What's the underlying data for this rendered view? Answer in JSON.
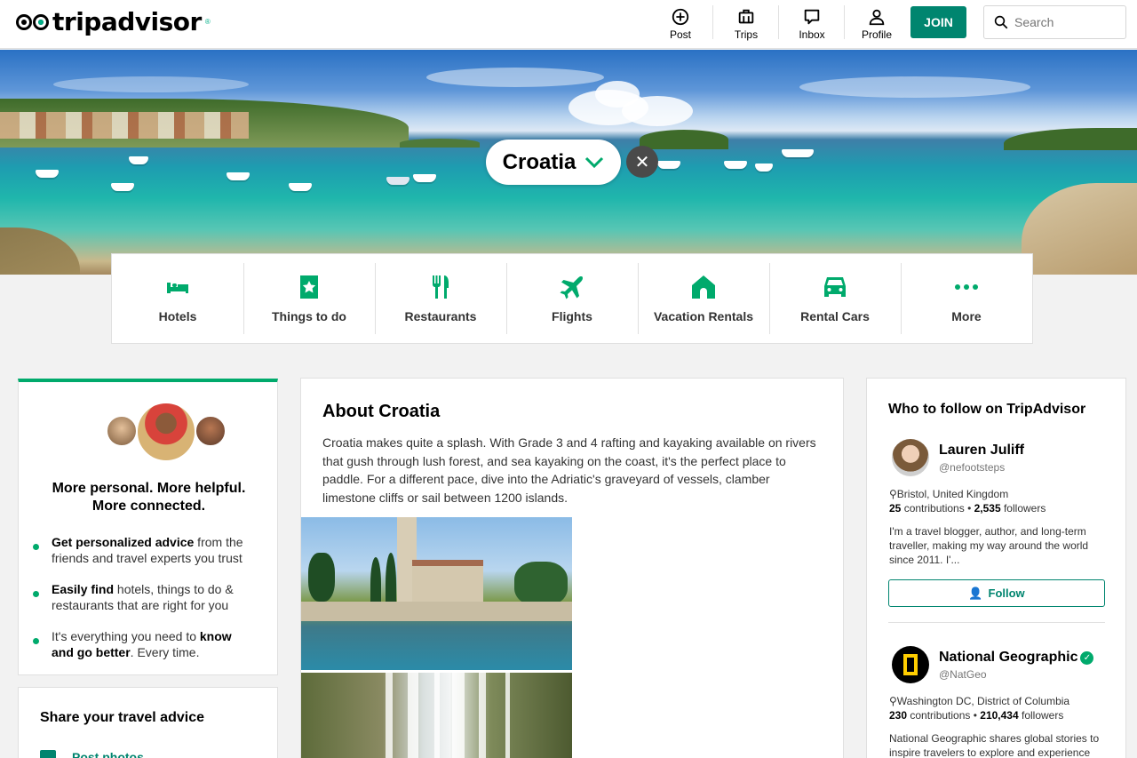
{
  "header": {
    "logo_text": "tripadvisor",
    "logo_reg": "®",
    "nav": [
      {
        "label": "Post",
        "icon": "plus-circle-icon"
      },
      {
        "label": "Trips",
        "icon": "briefcase-icon"
      },
      {
        "label": "Inbox",
        "icon": "chat-bubble-icon"
      },
      {
        "label": "Profile",
        "icon": "person-icon"
      }
    ],
    "join_label": "JOIN",
    "search_placeholder": "Search"
  },
  "hero": {
    "destination": "Croatia",
    "chevron": "chevron-down-icon",
    "close": "close-icon"
  },
  "categories": [
    {
      "label": "Hotels",
      "icon": "bed-icon"
    },
    {
      "label": "Things to do",
      "icon": "ticket-icon"
    },
    {
      "label": "Restaurants",
      "icon": "fork-knife-icon"
    },
    {
      "label": "Flights",
      "icon": "plane-icon"
    },
    {
      "label": "Vacation Rentals",
      "icon": "house-icon"
    },
    {
      "label": "Rental Cars",
      "icon": "car-icon"
    },
    {
      "label": "More",
      "icon": "more-dots-icon"
    }
  ],
  "promo": {
    "title_line1": "More personal. More helpful.",
    "title_line2": "More connected.",
    "benefits": [
      {
        "bold": "Get personalized advice",
        "rest": " from the friends and travel experts you trust"
      },
      {
        "bold": "Easily find",
        "rest": " hotels, things to do & restaurants that are right for you"
      },
      {
        "pre": "It's everything you need to ",
        "bold": "know and go better",
        "rest": ". Every time."
      }
    ]
  },
  "share": {
    "title": "Share your travel advice",
    "link": "Post photos"
  },
  "about": {
    "title": "About Croatia",
    "text": "Croatia makes quite a splash. With Grade 3 and 4 rafting and kayaking available on rivers that gush through lush forest, and sea kayaking on the coast, it's the perfect place to paddle. For a different pace, dive into the Adriatic's graveyard of vessels, clamber limestone cliffs or sail between 1200 islands."
  },
  "follow": {
    "title": "Who to follow on TripAdvisor",
    "people": [
      {
        "name": "Lauren Juliff",
        "handle": "@nefootsteps",
        "location": "Bristol, United Kingdom",
        "contributions": "25",
        "contributions_label": " contributions • ",
        "followers": "2,535",
        "followers_label": " followers",
        "bio": "I'm a travel blogger, author, and long-term traveller, making my way around the world since 2011. I'..."
      },
      {
        "name": "National Geographic",
        "handle": "@NatGeo",
        "location": "Washington DC, District of Columbia",
        "contributions": "230",
        "contributions_label": " contributions • ",
        "followers": "210,434",
        "followers_label": " followers",
        "bio": "National Geographic shares global stories to inspire travelers to explore and experience"
      }
    ],
    "follow_label": "Follow"
  },
  "colors": {
    "brand_green": "#00aa6c",
    "button_green": "#00856f"
  }
}
